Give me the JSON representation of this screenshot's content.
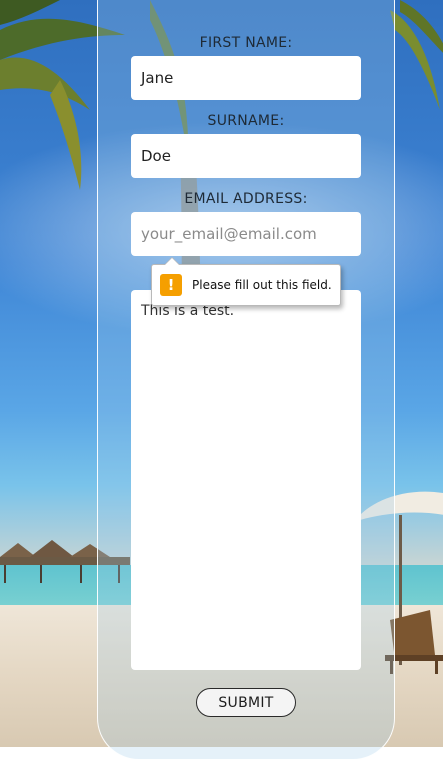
{
  "form": {
    "first_name_label": "FIRST NAME:",
    "first_name_value": "Jane",
    "surname_label": "SURNAME:",
    "surname_value": "Doe",
    "email_label": "EMAIL ADDRESS:",
    "email_placeholder": "your_email@email.com",
    "message_value": "This is a test.",
    "submit_label": "SUBMIT"
  },
  "validation_tooltip": {
    "icon": "warning-icon",
    "icon_glyph": "!",
    "message": "Please fill out this field."
  },
  "colors": {
    "warning": "#f59f00",
    "panel_border": "#ffffff",
    "field_background": "#ffffff"
  }
}
